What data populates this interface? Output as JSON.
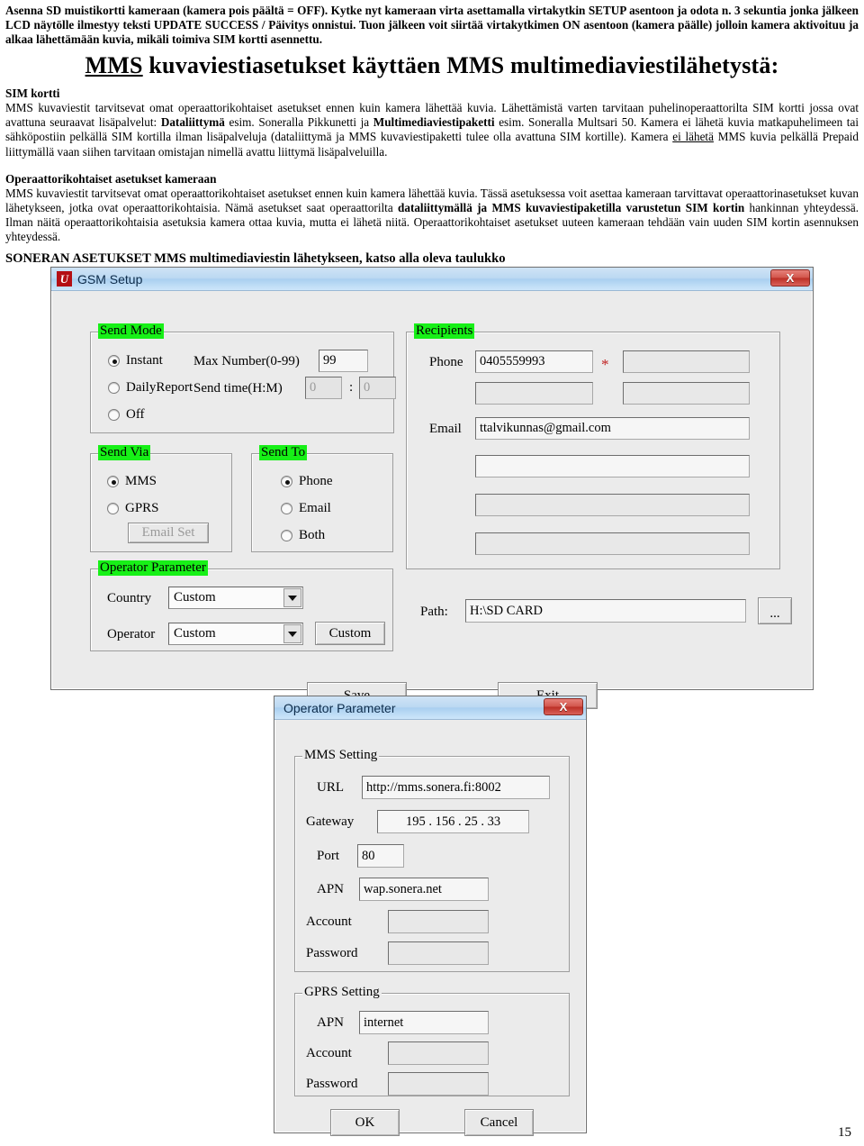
{
  "document": {
    "intro": "Asenna SD muistikortti kameraan (kamera pois päältä = OFF). Kytke nyt kameraan virta asettamalla virtakytkin SETUP asentoon ja odota n. 3 sekuntia jonka jälkeen LCD näytölle ilmestyy teksti UPDATE SUCCESS / Päivitys onnistui. Tuon jälkeen voit siirtää virtakytkimen ON asentoon (kamera päälle) jolloin kamera aktivoituu ja alkaa lähettämään kuvia, mikäli toimiva SIM kortti asennettu.",
    "title_underlined": "MMS",
    "title_rest": " kuvaviestiasetukset käyttäen MMS multimediaviestilähetystä:",
    "section1_head": "SIM kortti",
    "section1_p1a": "MMS kuvaviestit tarvitsevat omat operaattorikohtaiset asetukset ennen kuin kamera lähettää kuvia. Lähettämistä varten tarvitaan puhelinoperaattorilta SIM kortti jossa ovat avattuna seuraavat lisäpalvelut: ",
    "section1_b1": "Dataliittymä",
    "section1_p1b": " esim. Soneralla Pikkunetti ja ",
    "section1_b2": "Multimediaviestipaketti",
    "section1_p1c": " esim. Soneralla Multsari 50. Kamera ei lähetä kuvia matkapuhelimeen tai sähköpostiin pelkällä SIM kortilla ilman lisäpalveluja (dataliittymä ja MMS kuvaviestipaketti tulee olla avattuna SIM kortille). Kamera ",
    "section1_u1": "ei lähetä",
    "section1_p1d": " MMS kuvia pelkällä Prepaid liittymällä vaan siihen tarvitaan omistajan nimellä avattu liittymä lisäpalveluilla.",
    "section2_head": "Operaattorikohtaiset asetukset kameraan",
    "section2_p1a": "MMS kuvaviestit tarvitsevat omat operaattorikohtaiset asetukset ennen kuin kamera lähettää kuvia. Tässä asetuksessa voit asettaa kameraan tarvittavat operaattorinasetukset kuvan lähetykseen, jotka ovat operaattorikohtaisia. Nämä asetukset saat operaattorilta ",
    "section2_b1": "dataliittymällä ja MMS kuvaviestipaketilla varustetun SIM kortin",
    "section2_p1b": " hankinnan yhteydessä. Ilman näitä operaattorikohtaisia asetuksia kamera ottaa kuvia, mutta ei lähetä niitä. Operaattorikohtaiset asetukset uuteen kameraan tehdään vain uuden SIM kortin asennuksen yhteydessä.",
    "sonera_head": "SONERAN ASETUKSET MMS multimediaviestin lähetykseen, katso alla oleva taulukko",
    "page_number": "15"
  },
  "gsm_dialog": {
    "app_icon": "U",
    "title": "GSM Setup",
    "close_label": "X",
    "send_mode": {
      "legend": "Send Mode",
      "options": [
        {
          "label": "Instant",
          "selected": true
        },
        {
          "label": "DailyReport",
          "selected": false
        },
        {
          "label": "Off",
          "selected": false
        }
      ],
      "max_number_label": "Max Number(0-99)",
      "max_number_value": "99",
      "send_time_label": "Send time(H:M)",
      "send_time_hour": "0",
      "send_time_minute": "0",
      "send_time_separator": ":"
    },
    "send_via": {
      "legend": "Send Via",
      "options": [
        {
          "label": "MMS",
          "selected": true
        },
        {
          "label": "GPRS",
          "selected": false
        }
      ],
      "email_set_button": "Email Set"
    },
    "send_to": {
      "legend": "Send To",
      "options": [
        {
          "label": "Phone",
          "selected": true
        },
        {
          "label": "Email",
          "selected": false
        },
        {
          "label": "Both",
          "selected": false
        }
      ]
    },
    "operator_parameter": {
      "legend": "Operator Parameter",
      "country_label": "Country",
      "country_value": "Custom",
      "operator_label": "Operator",
      "operator_value": "Custom",
      "custom_button": "Custom"
    },
    "recipients": {
      "legend": "Recipients",
      "phone_label": "Phone",
      "phone_1": "0405559993",
      "phone_2": "",
      "phone_3": "",
      "phone_4": "",
      "required_mark": "*",
      "email_label": "Email",
      "email_1": "ttalvikunnas@gmail.com",
      "email_2": "",
      "email_3": "",
      "email_4": ""
    },
    "path_label": "Path:",
    "path_value": "H:\\SD CARD",
    "browse_button": "...",
    "save_button": "Save",
    "exit_button": "Exit"
  },
  "operator_dialog": {
    "title": "Operator Parameter",
    "close_label": "X",
    "mms_setting": {
      "legend": "MMS Setting",
      "url_label": "URL",
      "url_value": "http://mms.sonera.fi:8002",
      "gateway_label": "Gateway",
      "gateway_value": "195 . 156 . 25 . 33",
      "port_label": "Port",
      "port_value": "80",
      "apn_label": "APN",
      "apn_value": "wap.sonera.net",
      "account_label": "Account",
      "account_value": "",
      "password_label": "Password",
      "password_value": ""
    },
    "gprs_setting": {
      "legend": "GPRS Setting",
      "apn_label": "APN",
      "apn_value": "internet",
      "account_label": "Account",
      "account_value": "",
      "password_label": "Password",
      "password_value": ""
    },
    "ok_button": "OK",
    "cancel_button": "Cancel"
  },
  "colors": {
    "highlight_green": "#17f017",
    "close_red": "#bc2f26",
    "required_red": "#c02020",
    "titlebar_blue": "#aacff0"
  }
}
